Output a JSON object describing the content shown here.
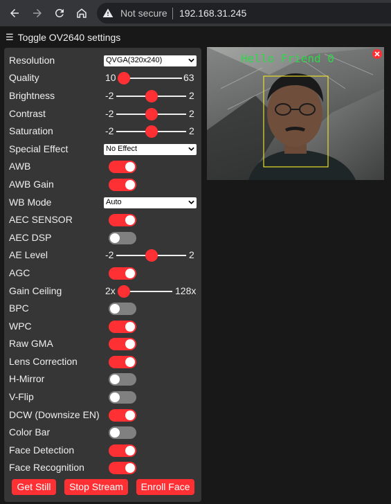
{
  "browser": {
    "security_label": "Not secure",
    "url": "192.168.31.245"
  },
  "header": {
    "toggle_label": "Toggle OV2640 settings"
  },
  "settings": {
    "resolution": {
      "label": "Resolution",
      "value": "QVGA(320x240)"
    },
    "quality": {
      "label": "Quality",
      "min": "10",
      "max": "63",
      "value": 10
    },
    "brightness": {
      "label": "Brightness",
      "min": "-2",
      "max": "2",
      "value": 0
    },
    "contrast": {
      "label": "Contrast",
      "min": "-2",
      "max": "2",
      "value": 0
    },
    "saturation": {
      "label": "Saturation",
      "min": "-2",
      "max": "2",
      "value": 0
    },
    "special_effect": {
      "label": "Special Effect",
      "value": "No Effect"
    },
    "awb": {
      "label": "AWB",
      "on": true
    },
    "awb_gain": {
      "label": "AWB Gain",
      "on": true
    },
    "wb_mode": {
      "label": "WB Mode",
      "value": "Auto"
    },
    "aec_sensor": {
      "label": "AEC SENSOR",
      "on": true
    },
    "aec_dsp": {
      "label": "AEC DSP",
      "on": false
    },
    "ae_level": {
      "label": "AE Level",
      "min": "-2",
      "max": "2",
      "value": 0
    },
    "agc": {
      "label": "AGC",
      "on": true
    },
    "gain_ceiling": {
      "label": "Gain Ceiling",
      "min": "2x",
      "max": "128x",
      "value": 0
    },
    "bpc": {
      "label": "BPC",
      "on": false
    },
    "wpc": {
      "label": "WPC",
      "on": true
    },
    "raw_gma": {
      "label": "Raw GMA",
      "on": true
    },
    "lens_correction": {
      "label": "Lens Correction",
      "on": true
    },
    "h_mirror": {
      "label": "H-Mirror",
      "on": false
    },
    "v_flip": {
      "label": "V-Flip",
      "on": false
    },
    "dcw": {
      "label": "DCW (Downsize EN)",
      "on": true
    },
    "color_bar": {
      "label": "Color Bar",
      "on": false
    },
    "face_detection": {
      "label": "Face Detection",
      "on": true
    },
    "face_recognition": {
      "label": "Face Recognition",
      "on": true
    }
  },
  "buttons": {
    "get_still": "Get Still",
    "stop_stream": "Stop Stream",
    "enroll_face": "Enroll Face"
  },
  "stream": {
    "overlay_text": "Hello Friend 0"
  },
  "colors": {
    "accent": "#ff3034",
    "panel": "#363636",
    "background": "#181818",
    "overlay_text": "#2ed84a",
    "face_box": "#e8df2b"
  }
}
